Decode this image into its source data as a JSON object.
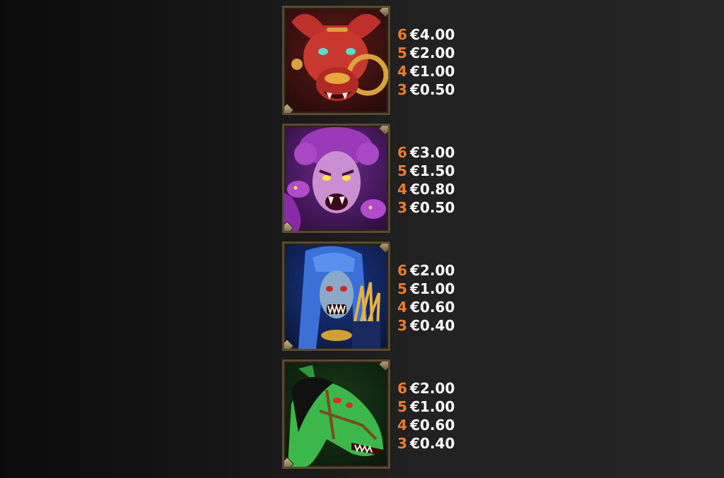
{
  "colors": {
    "count": "#f07a2c",
    "value": "#ffffff",
    "frame": "#5a4a32"
  },
  "symbols": [
    {
      "icon": "red-bull-demon-icon",
      "pays": [
        {
          "count": "6",
          "value": "€4.00"
        },
        {
          "count": "5",
          "value": "€2.00"
        },
        {
          "count": "4",
          "value": "€1.00"
        },
        {
          "count": "3",
          "value": "€0.50"
        }
      ]
    },
    {
      "icon": "purple-medusa-icon",
      "pays": [
        {
          "count": "6",
          "value": "€3.00"
        },
        {
          "count": "5",
          "value": "€1.50"
        },
        {
          "count": "4",
          "value": "€0.80"
        },
        {
          "count": "3",
          "value": "€0.50"
        }
      ]
    },
    {
      "icon": "blue-banshee-icon",
      "pays": [
        {
          "count": "6",
          "value": "€2.00"
        },
        {
          "count": "5",
          "value": "€1.00"
        },
        {
          "count": "4",
          "value": "€0.60"
        },
        {
          "count": "3",
          "value": "€0.40"
        }
      ]
    },
    {
      "icon": "green-horse-icon",
      "pays": [
        {
          "count": "6",
          "value": "€2.00"
        },
        {
          "count": "5",
          "value": "€1.00"
        },
        {
          "count": "4",
          "value": "€0.60"
        },
        {
          "count": "3",
          "value": "€0.40"
        }
      ]
    }
  ]
}
